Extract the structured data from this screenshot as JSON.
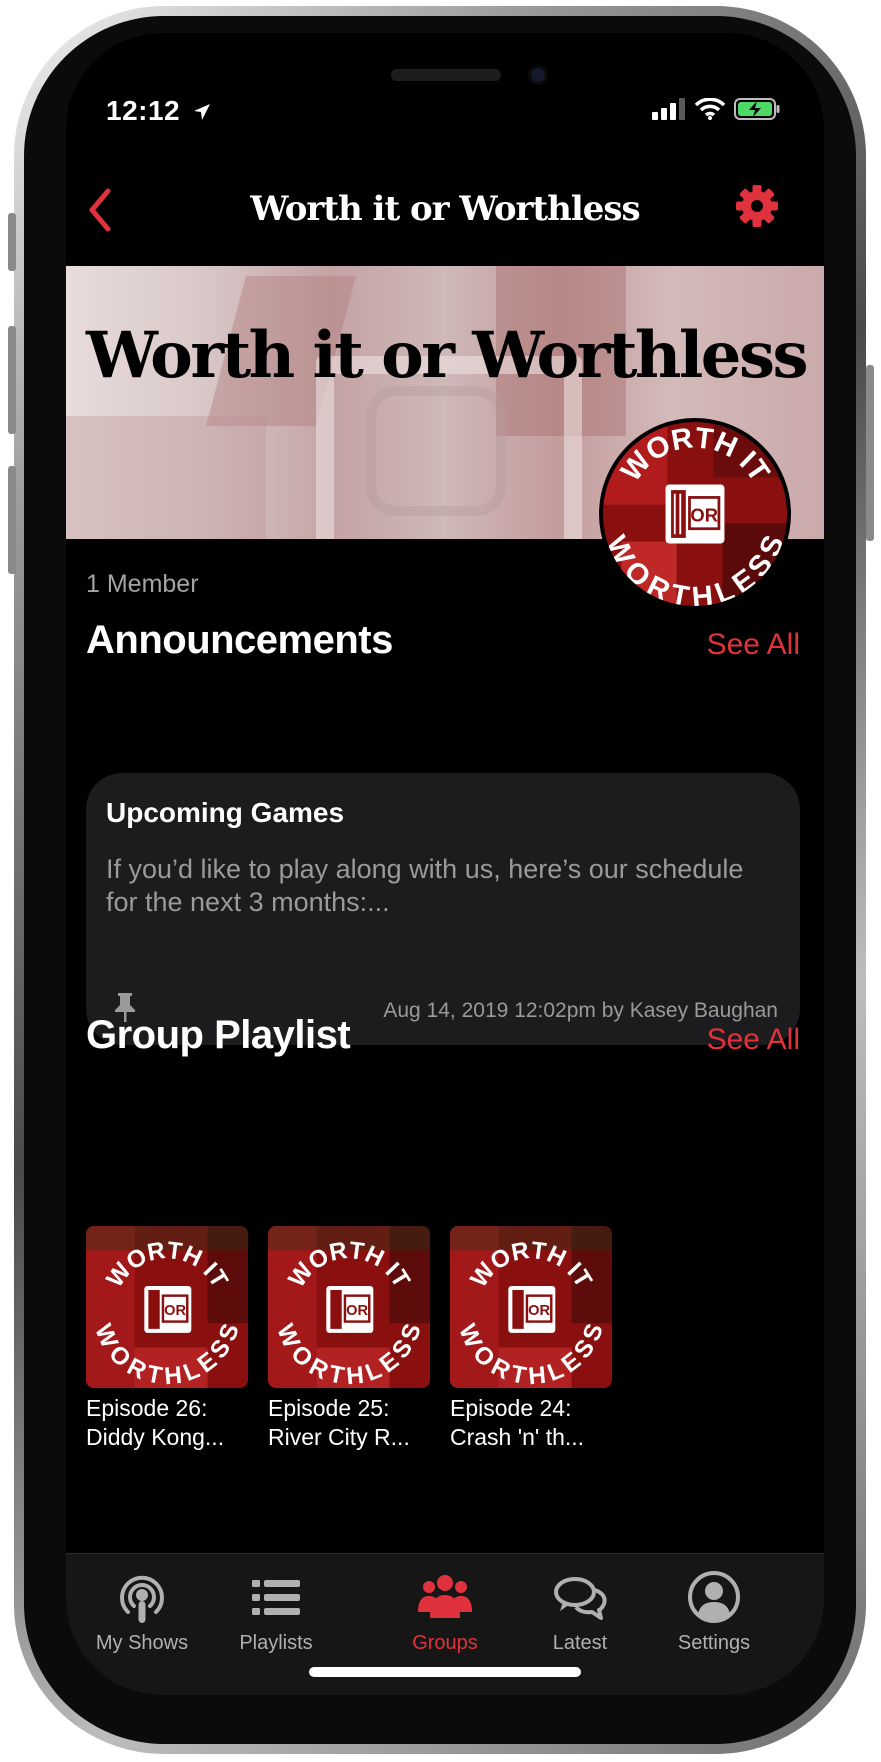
{
  "status": {
    "time": "12:12"
  },
  "nav": {
    "title": "Worth it or Worthless"
  },
  "group": {
    "banner_title": "Worth it or Worthless",
    "member_count": "1 Member",
    "logo_text_top": "WORTH IT",
    "logo_text_mid": "OR",
    "logo_text_bottom": "WORTHLESS"
  },
  "announcements": {
    "heading": "Announcements",
    "see_all": "See All",
    "card": {
      "title": "Upcoming Games",
      "body": "If you’d like to play along with us, here’s our schedule for the next 3 months:...",
      "meta": "Aug 14, 2019 12:02pm by Kasey Baughan"
    }
  },
  "playlist": {
    "heading": "Group Playlist",
    "see_all": "See All",
    "episodes": [
      {
        "line1": "Episode 26:",
        "line2": "Diddy Kong..."
      },
      {
        "line1": "Episode 25:",
        "line2": "River City R..."
      },
      {
        "line1": "Episode 24:",
        "line2": "Crash 'n' th..."
      }
    ]
  },
  "tabs": [
    {
      "label": "My Shows",
      "icon": "podcast-icon"
    },
    {
      "label": "Playlists",
      "icon": "list-icon"
    },
    {
      "label": "Groups",
      "icon": "people-icon",
      "active": true
    },
    {
      "label": "Latest",
      "icon": "chat-bubbles-icon"
    },
    {
      "label": "Settings",
      "icon": "user-circle-icon"
    }
  ],
  "colors": {
    "accent": "#e0323c",
    "background": "#000000",
    "card": "#1c1c1e"
  }
}
